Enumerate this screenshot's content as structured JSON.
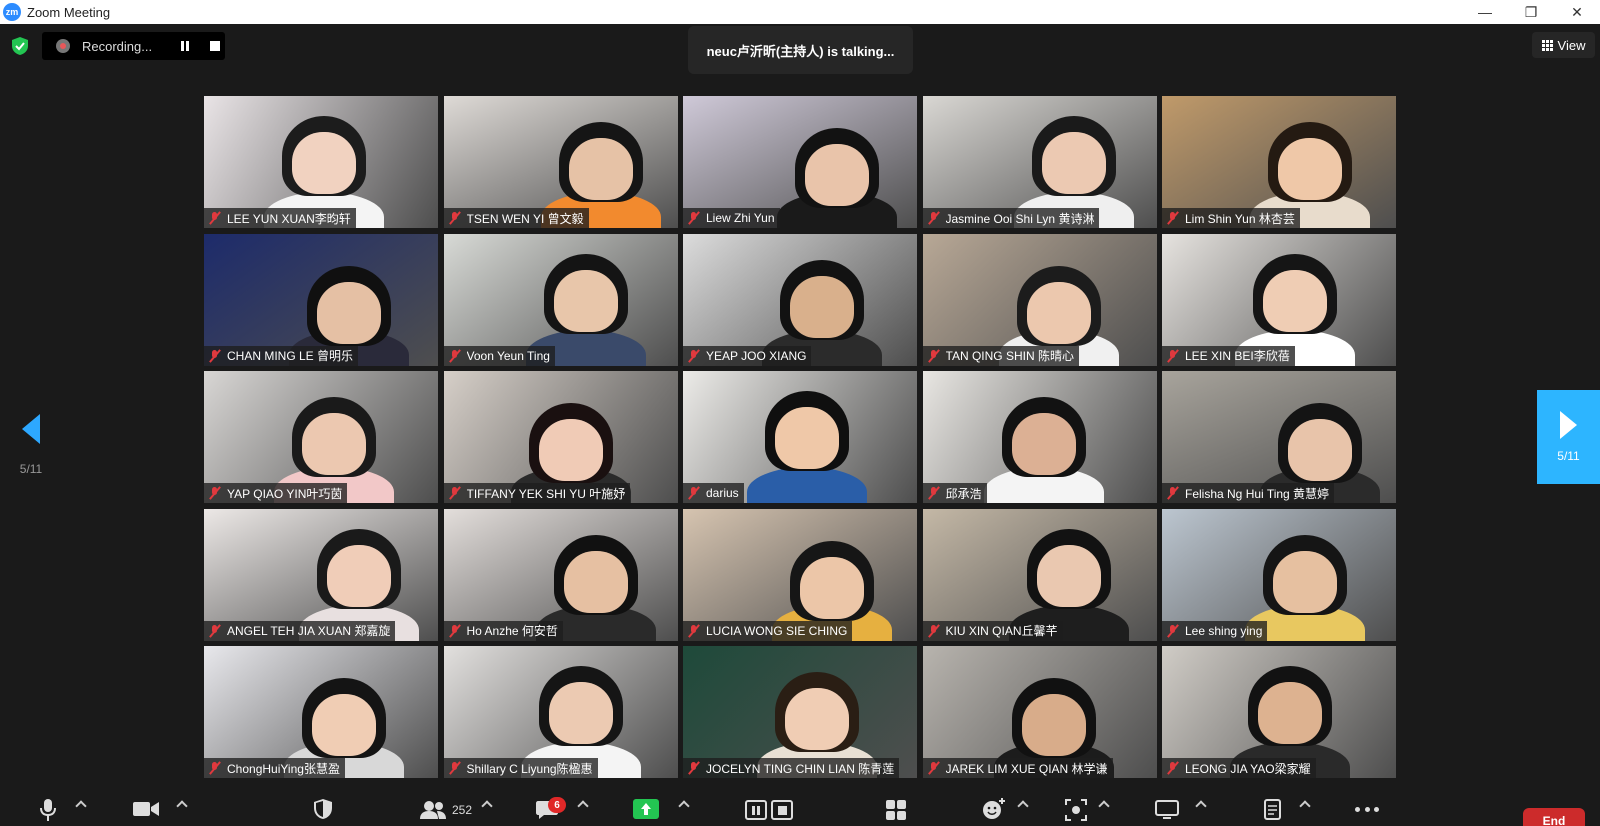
{
  "window": {
    "title": "Zoom Meeting",
    "logo_text": "zm"
  },
  "recording": {
    "label": "Recording..."
  },
  "speaker_banner": {
    "text": "neuc卢沂昕(主持人)   is talking..."
  },
  "view_button": {
    "label": "View"
  },
  "pager": {
    "left_label": "5/11",
    "right_label": "5/11"
  },
  "participants": [
    {
      "name": "LEE YUN XUAN李昀轩",
      "bg": "#e9e4e6",
      "skin": "#f1d2c0",
      "hair": "#1c1c1c",
      "shirt": "#f4f4f4"
    },
    {
      "name": "TSEN WEN YI 曾文毅",
      "bg": "#dedad6",
      "skin": "#e6c2a6",
      "hair": "#151515",
      "shirt": "#f28a2e"
    },
    {
      "name": "Liew Zhi Yun",
      "bg": "#cfc9d8",
      "skin": "#e9c4aa",
      "hair": "#121212",
      "shirt": "#1a1a1a"
    },
    {
      "name": "Jasmine Ooi Shi Lyn 黄诗淋",
      "bg": "#d9d7d3",
      "skin": "#ecc9b2",
      "hair": "#1a1a1a",
      "shirt": "#efefef"
    },
    {
      "name": "Lim Shin Yun 林杏芸",
      "bg": "#c09a6a",
      "skin": "#efc8a8",
      "hair": "#241a12",
      "shirt": "#e8dccc"
    },
    {
      "name": "CHAN MING LE 曾明乐",
      "bg": "#1d2b6b",
      "skin": "#e5c0a4",
      "hair": "#101010",
      "shirt": "#2a2a3a"
    },
    {
      "name": "Voon Yeun Ting",
      "bg": "#d8dad6",
      "skin": "#e8c6aa",
      "hair": "#141414",
      "shirt": "#3a4a6a"
    },
    {
      "name": "YEAP JOO XIANG",
      "bg": "#dcdcdc",
      "skin": "#d9b08c",
      "hair": "#121212",
      "shirt": "#2b2b2b"
    },
    {
      "name": "TAN QING SHIN 陈晴心",
      "bg": "#b8a896",
      "skin": "#ecc8ae",
      "hair": "#1c1c1c",
      "shirt": "#f0f0f0"
    },
    {
      "name": "LEE XIN BEI李欣蓓",
      "bg": "#e6e3df",
      "skin": "#efcdb4",
      "hair": "#151515",
      "shirt": "#ffffff"
    },
    {
      "name": "YAP QIAO YIN叶巧茵",
      "bg": "#d8d6d4",
      "skin": "#ecc8b0",
      "hair": "#1a1a1a",
      "shirt": "#f2c8c8"
    },
    {
      "name": "TIFFANY YEK SHI YU 叶施妤",
      "bg": "#d6cfc8",
      "skin": "#f0cbb6",
      "hair": "#1a1010",
      "shirt": "#2a2a2a"
    },
    {
      "name": "darius",
      "bg": "#ecebe8",
      "skin": "#efc8a8",
      "hair": "#0f0f0f",
      "shirt": "#2a5ea8"
    },
    {
      "name": "邱承浩",
      "bg": "#e8e6e2",
      "skin": "#dcb094",
      "hair": "#121212",
      "shirt": "#f4f4f4"
    },
    {
      "name": "Felisha Ng Hui Ting 黄慧婷",
      "bg": "#a8a49c",
      "skin": "#e8c4aa",
      "hair": "#141414",
      "shirt": "#2b2b2b"
    },
    {
      "name": "ANGEL TEH JIA XUAN 郑嘉旋",
      "bg": "#ece8e6",
      "skin": "#f0cdb8",
      "hair": "#1a1a1a",
      "shirt": "#e8e0e0"
    },
    {
      "name": "Ho Anzhe 何安哲",
      "bg": "#e3dedb",
      "skin": "#e6c0a2",
      "hair": "#111111",
      "shirt": "#2a2a2a"
    },
    {
      "name": "LUCIA WONG SIE CHING",
      "bg": "#d6c4b0",
      "skin": "#ecc6a8",
      "hair": "#161616",
      "shirt": "#e6b040"
    },
    {
      "name": "KIU XIN QIAN丘馨芊",
      "bg": "#c4b8a6",
      "skin": "#eac8b0",
      "hair": "#121212",
      "shirt": "#1e1e1e"
    },
    {
      "name": "Lee shing ying",
      "bg": "#bcc6d0",
      "skin": "#e6c0a0",
      "hair": "#151515",
      "shirt": "#e8c860"
    },
    {
      "name": "ChongHuiYing张慧盈",
      "bg": "#e8e8ec",
      "skin": "#f0cdb4",
      "hair": "#141414",
      "shirt": "#d8d8d8"
    },
    {
      "name": "Shillary C Liyung陈楹惠",
      "bg": "#e2e0de",
      "skin": "#eccab2",
      "hair": "#151515",
      "shirt": "#f4f4f4"
    },
    {
      "name": "JOCELYN TING CHIN LIAN 陈青莲",
      "bg": "#1e4a3a",
      "skin": "#f0cdb4",
      "hair": "#2a1e14",
      "shirt": "#e8e0d4"
    },
    {
      "name": "JAREK LIM XUE QIAN 林学谦",
      "bg": "#b8b4ae",
      "skin": "#d8ac8a",
      "hair": "#111111",
      "shirt": "#1c1c1c"
    },
    {
      "name": "LEONG JIA YAO梁家耀",
      "bg": "#d0ccc6",
      "skin": "#ddb290",
      "hair": "#121212",
      "shirt": "#2a2a2a"
    }
  ],
  "toolbar": {
    "participants_count": "252",
    "chat_badge": "6",
    "end_label": "End"
  }
}
